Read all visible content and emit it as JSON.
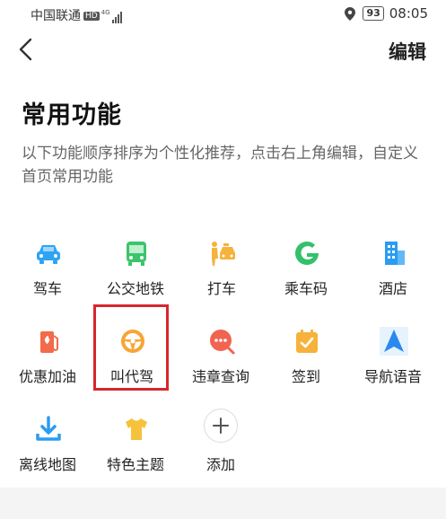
{
  "status_bar": {
    "carrier": "中国联通",
    "hd": "HD",
    "network": "4G",
    "battery": "93",
    "time": "08:05"
  },
  "nav": {
    "edit_label": "编辑"
  },
  "page": {
    "title": "常用功能",
    "description": "以下功能顺序排序为个性化推荐，点击右上角编辑，自定义首页常用功能"
  },
  "items": [
    {
      "label": "驾车",
      "icon": "car-icon",
      "color": "#2ea4f2"
    },
    {
      "label": "公交地铁",
      "icon": "bus-icon",
      "color": "#3cc46c"
    },
    {
      "label": "打车",
      "icon": "taxi-icon",
      "color": "#f7b23b"
    },
    {
      "label": "乘车码",
      "icon": "ride-code-icon",
      "color": "#33c16b"
    },
    {
      "label": "酒店",
      "icon": "hotel-icon",
      "color": "#2b9cf2"
    },
    {
      "label": "优惠加油",
      "icon": "gas-station-icon",
      "color": "#f26b4a"
    },
    {
      "label": "叫代驾",
      "icon": "steering-wheel-icon",
      "color": "#f7a534"
    },
    {
      "label": "违章查询",
      "icon": "violation-search-icon",
      "color": "#f06450"
    },
    {
      "label": "签到",
      "icon": "checkin-calendar-icon",
      "color": "#f7b23b"
    },
    {
      "label": "导航语音",
      "icon": "navigation-arrow-icon",
      "color": "#2b88f0"
    },
    {
      "label": "离线地图",
      "icon": "download-icon",
      "color": "#2b9cf2"
    },
    {
      "label": "特色主题",
      "icon": "tshirt-icon",
      "color": "#f7c23b"
    },
    {
      "label": "添加",
      "icon": "plus-icon",
      "color": "#555555"
    }
  ],
  "highlight_color": "#d8262b"
}
